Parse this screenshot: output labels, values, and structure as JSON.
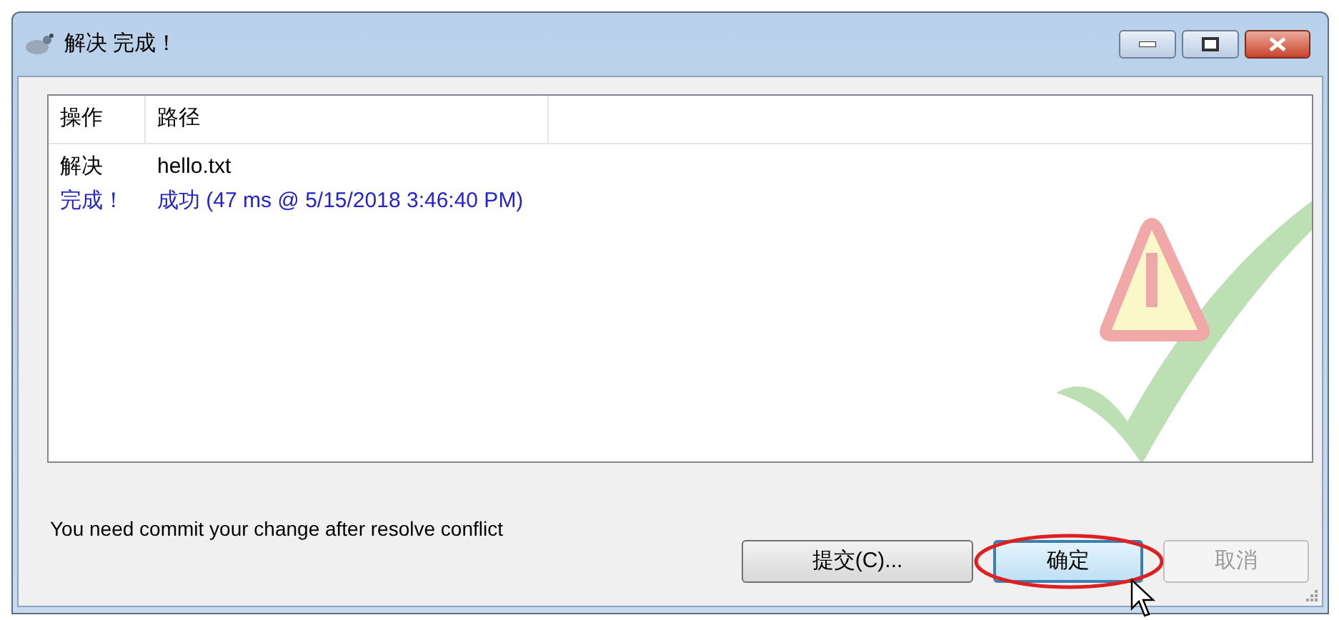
{
  "window": {
    "title": "解决 完成！"
  },
  "table": {
    "columns": [
      "操作",
      "路径"
    ],
    "rows": [
      {
        "cells": [
          "解决",
          "hello.txt"
        ],
        "color": "#000000"
      },
      {
        "cells": [
          "完成！",
          "成功 (47 ms @ 5/15/2018 3:46:40 PM)"
        ],
        "color": "#2424c8"
      }
    ]
  },
  "message": "You need commit your change after resolve conflict",
  "buttons": [
    {
      "label": "提交(C)...",
      "default": false,
      "disabled": false,
      "circled": false
    },
    {
      "label": "确定",
      "default": true,
      "disabled": false,
      "circled": true
    },
    {
      "label": "取消",
      "default": false,
      "disabled": true,
      "circled": false
    }
  ]
}
